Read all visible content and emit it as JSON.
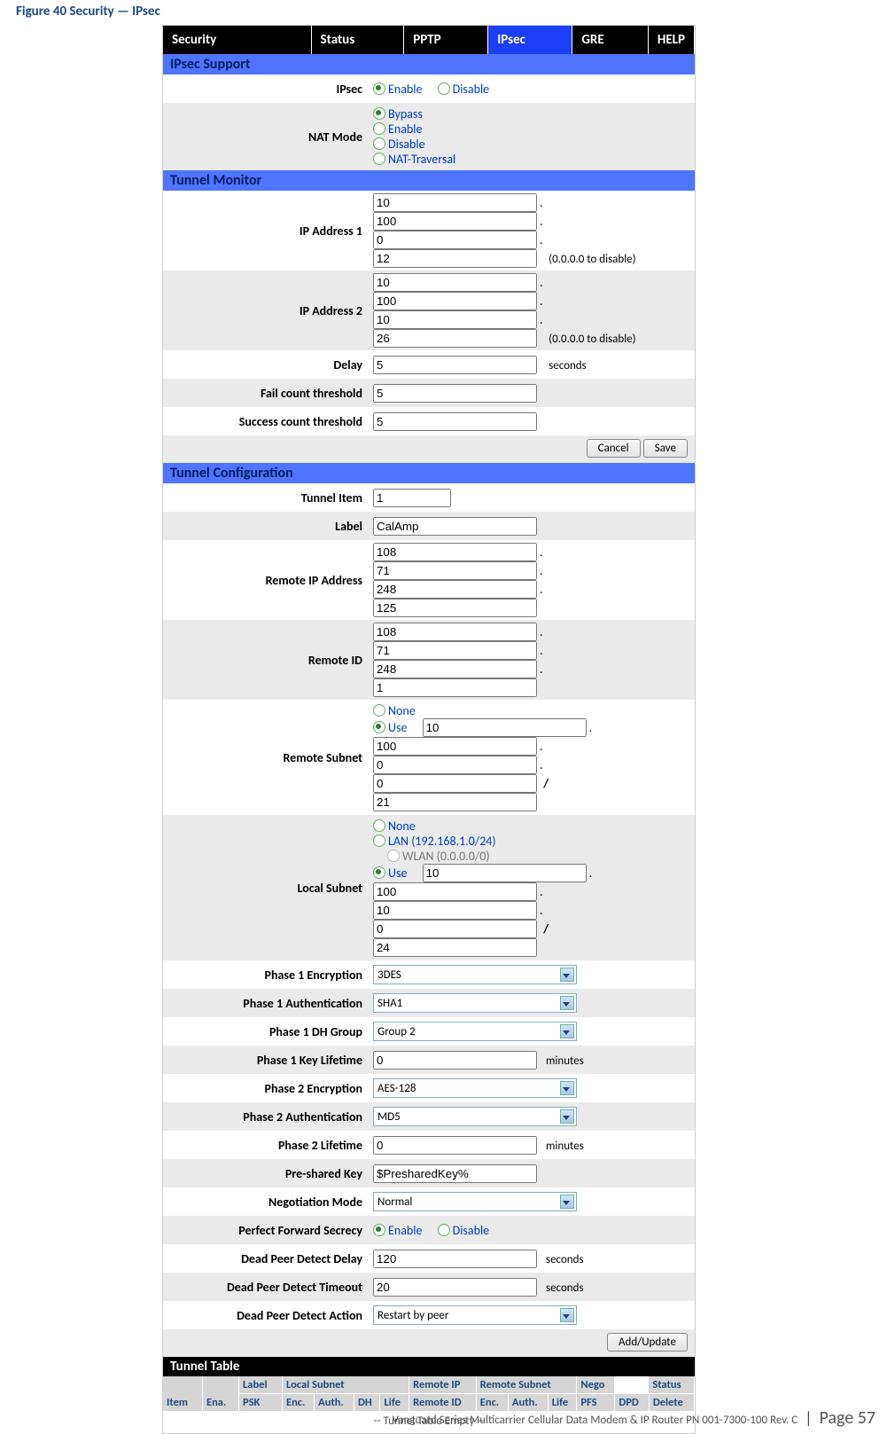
{
  "caption": "Figure 40 Security — IPsec",
  "tabs": {
    "security": "Security",
    "status": "Status",
    "pptp": "PPTP",
    "ipsec": "IPsec",
    "gre": "GRE",
    "help": "HELP"
  },
  "sec_support": "IPsec Support",
  "ipsec": {
    "label": "IPsec",
    "enable": "Enable",
    "disable": "Disable",
    "nat_label": "NAT Mode",
    "bypass": "Bypass",
    "nat_enable": "Enable",
    "nat_disable": "Disable",
    "nat_trav": "NAT-Traversal"
  },
  "sec_monitor": "Tunnel Monitor",
  "mon": {
    "ip1": "IP Address 1",
    "ip1v": [
      "10",
      "100",
      "0",
      "12"
    ],
    "ip1n": "(0.0.0.0 to disable)",
    "ip2": "IP Address 2",
    "ip2v": [
      "10",
      "100",
      "10",
      "26"
    ],
    "ip2n": "(0.0.0.0 to disable)",
    "delay": "Delay",
    "delayv": "5",
    "delayu": "seconds",
    "fail": "Fail count threshold",
    "failv": "5",
    "succ": "Success count threshold",
    "succv": "5"
  },
  "btns": {
    "cancel": "Cancel",
    "save": "Save",
    "add": "Add/Update"
  },
  "sec_conf": "Tunnel Configuration",
  "conf": {
    "item": "Tunnel Item",
    "itemv": "1",
    "label": "Label",
    "labelv": "CalAmp",
    "rip": "Remote IP Address",
    "ripv": [
      "108",
      "71",
      "248",
      "125"
    ],
    "rid": "Remote ID",
    "ridv": [
      "108",
      "71",
      "248",
      "1"
    ],
    "rsub": "Remote Subnet",
    "none": "None",
    "use": "Use",
    "rsv": [
      "10",
      "100",
      "0",
      "0"
    ],
    "rsp": "21",
    "lsub": "Local Subnet",
    "lan": "LAN (192.168.1.0/24)",
    "wlan": "WLAN (0.0.0.0/0)",
    "lsv": [
      "10",
      "100",
      "10",
      "0"
    ],
    "lsp": "24",
    "p1e": "Phase 1 Encryption",
    "p1ev": "3DES",
    "p1a": "Phase 1 Authentication",
    "p1av": "SHA1",
    "p1d": "Phase 1 DH Group",
    "p1dv": "Group 2",
    "p1k": "Phase 1 Key Lifetime",
    "p1kv": "0",
    "min": "minutes",
    "p2e": "Phase 2 Encryption",
    "p2ev": "AES-128",
    "p2a": "Phase 2 Authentication",
    "p2av": "MD5",
    "p2l": "Phase 2 Lifetime",
    "p2lv": "0",
    "psk": "Pre-shared Key",
    "pskv": "$PresharedKey%",
    "neg": "Negotiation Mode",
    "negv": "Normal",
    "pfs": "Perfect Forward Secrecy",
    "pfse": "Enable",
    "pfsd": "Disable",
    "dpdD": "Dead Peer Detect Delay",
    "dpdDv": "120",
    "sec": "seconds",
    "dpdT": "Dead Peer Detect Timeout",
    "dpdTv": "20",
    "dpdA": "Dead Peer Detect Action",
    "dpdAv": "Restart by peer"
  },
  "sec_table": "Tunnel Table",
  "tt": {
    "r1": {
      "label": "Label",
      "lsub": "Local Subnet",
      "rip": "Remote IP",
      "rsub": "Remote Subnet",
      "nego": "Nego",
      "status": "Status"
    },
    "r2": {
      "item": "Item",
      "ena": "Ena.",
      "psk": "PSK",
      "enc": "Enc.",
      "auth": "Auth.",
      "dh": "DH",
      "life": "Life",
      "rid": "Remote ID",
      "enc2": "Enc.",
      "auth2": "Auth.",
      "life2": "Life",
      "pfs": "PFS",
      "dpd": "DPD",
      "del": "Delete"
    },
    "empty": "-- Tunnel Table Empty --"
  },
  "footer": {
    "doc": "Vanguard Series Multicarrier Cellular Data Modem & IP Router PN 001-7300-100 Rev. C",
    "page": "Page 57"
  }
}
